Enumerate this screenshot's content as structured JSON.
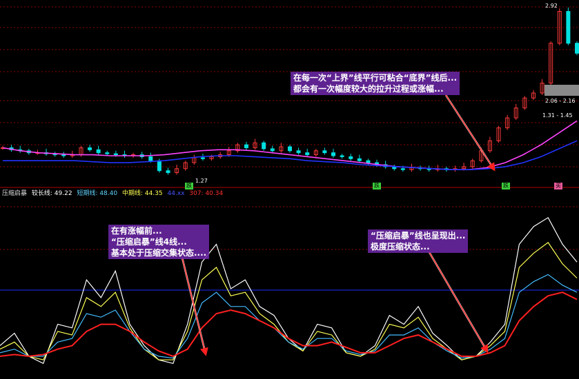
{
  "header": {
    "top_text": ""
  },
  "indicator": {
    "name": "压缩启暴",
    "items": [
      "较长线: 49.22",
      "短期线: 48.40",
      "中期线: 44.35",
      "44.xx",
      "307: 40.34"
    ]
  },
  "annotations": {
    "upper": [
      "在每一次“上界”线平行可粘合“底界”线后...",
      "都会有一次幅度较大的拉升过程或涨幅..."
    ],
    "left": [
      "在有涨幅前...",
      "“压缩启暴”线4线...",
      "基本处于压缩交集状态...."
    ],
    "right": [
      "“压缩启暴”线也呈现出...",
      "极度压缩状态..."
    ]
  },
  "colors": {
    "up": "#ff3a3a",
    "down": "#00e0e0",
    "ma_magenta": "#ff44ff",
    "ma_blue": "#2233ff",
    "ma_white": "#ffffff",
    "ind_white": "#ffffff",
    "ind_yellow": "#ffff55",
    "ind_cyan": "#44bbff",
    "ind_red": "#ff2020",
    "grid": "#8b0000"
  },
  "chart_data": [
    {
      "type": "candlestick",
      "panel": "price",
      "ohlc_approx_path": [
        1.55,
        1.53,
        1.52,
        1.5,
        1.5,
        1.49,
        1.48,
        1.47,
        1.48,
        1.55,
        1.53,
        1.5,
        1.49,
        1.48,
        1.47,
        1.48,
        1.46,
        1.42,
        1.32,
        1.3,
        1.34,
        1.4,
        1.45,
        1.44,
        1.46,
        1.48,
        1.52,
        1.58,
        1.55,
        1.6,
        1.54,
        1.52,
        1.56,
        1.52,
        1.5,
        1.48,
        1.52,
        1.5,
        1.47,
        1.46,
        1.44,
        1.42,
        1.4,
        1.38,
        1.36,
        1.34,
        1.33,
        1.35,
        1.34,
        1.33,
        1.34,
        1.33,
        1.34,
        1.36,
        1.42,
        1.52,
        1.62,
        1.75,
        1.85,
        1.95,
        2.05,
        2.1,
        2.2,
        2.6,
        2.92,
        2.6,
        2.5
      ],
      "price_labels": {
        "high": "2.92",
        "range_1": "2.06 - 2.16",
        "range_2": "1.31 - 1.45",
        "low": "1.27"
      },
      "tags": [
        "跌",
        "跌",
        "跌",
        "买"
      ],
      "moving_averages": [
        {
          "color": "magenta",
          "values": [
            1.55,
            1.52,
            1.5,
            1.49,
            1.48,
            1.48,
            1.47,
            1.47,
            1.47,
            1.48,
            1.5,
            1.52,
            1.53,
            1.53,
            1.52,
            1.5,
            1.48,
            1.46,
            1.44,
            1.42,
            1.4,
            1.38,
            1.36,
            1.35,
            1.34,
            1.33,
            1.33,
            1.35,
            1.4,
            1.48,
            1.58,
            1.7,
            1.82
          ]
        },
        {
          "color": "blue",
          "values": [
            1.42,
            1.42,
            1.42,
            1.42,
            1.42,
            1.41,
            1.4,
            1.4,
            1.41,
            1.42,
            1.44,
            1.46,
            1.47,
            1.47,
            1.46,
            1.45,
            1.44,
            1.42,
            1.41,
            1.4,
            1.38,
            1.37,
            1.36,
            1.35,
            1.34,
            1.33,
            1.33,
            1.34,
            1.36,
            1.4,
            1.46,
            1.54,
            1.62
          ]
        }
      ]
    },
    {
      "type": "line",
      "panel": "indicator",
      "ylim": [
        0,
        100
      ],
      "series": [
        {
          "name": "较长线",
          "color": "white",
          "values": [
            18,
            25,
            12,
            8,
            30,
            28,
            55,
            45,
            60,
            30,
            18,
            10,
            8,
            30,
            65,
            75,
            50,
            55,
            40,
            35,
            22,
            15,
            30,
            28,
            14,
            12,
            18,
            35,
            30,
            40,
            25,
            18,
            10,
            12,
            20,
            30,
            75,
            85,
            90,
            75,
            65
          ]
        },
        {
          "name": "短期线",
          "color": "yellow",
          "values": [
            16,
            20,
            12,
            10,
            26,
            24,
            45,
            40,
            48,
            28,
            16,
            10,
            10,
            26,
            55,
            62,
            46,
            48,
            36,
            30,
            20,
            15,
            26,
            24,
            14,
            12,
            16,
            30,
            28,
            34,
            22,
            16,
            10,
            12,
            18,
            26,
            62,
            70,
            76,
            64,
            56
          ]
        },
        {
          "name": "中期线",
          "color": "cyan",
          "values": [
            14,
            16,
            12,
            12,
            20,
            22,
            36,
            34,
            38,
            26,
            16,
            12,
            11,
            22,
            42,
            48,
            40,
            40,
            32,
            28,
            20,
            16,
            22,
            22,
            15,
            13,
            15,
            24,
            24,
            28,
            20,
            15,
            11,
            12,
            16,
            22,
            48,
            54,
            58,
            52,
            48
          ]
        },
        {
          "name": "307",
          "color": "red",
          "values": [
            12,
            13,
            12,
            13,
            16,
            18,
            26,
            30,
            30,
            26,
            20,
            15,
            12,
            16,
            28,
            36,
            38,
            36,
            32,
            28,
            22,
            18,
            18,
            20,
            17,
            14,
            14,
            18,
            22,
            24,
            20,
            16,
            12,
            12,
            14,
            18,
            32,
            40,
            46,
            48,
            44
          ]
        }
      ]
    }
  ]
}
